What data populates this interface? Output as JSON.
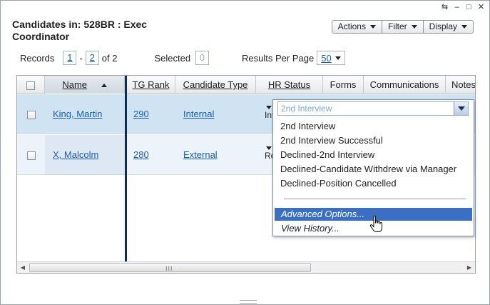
{
  "window": {
    "title_line": "Candidates in: 528BR : Exec Coordinator",
    "controls": {
      "refresh": "⇆",
      "minimize": "–",
      "maximize": "□",
      "close": "✕"
    }
  },
  "toolbar": {
    "actions": "Actions",
    "filter": "Filter",
    "display": "Display"
  },
  "pager": {
    "records_label": "Records",
    "start": "1",
    "dash": "-",
    "end": "2",
    "of_total": "of 2",
    "selected_label": "Selected",
    "selected_count": "0",
    "rpp_label": "Results Per Page",
    "rpp_value": "50"
  },
  "grid": {
    "columns": [
      "Name",
      "TG Rank",
      "Candidate Type",
      "HR Status",
      "Forms",
      "Communications",
      "Notes"
    ],
    "rows": [
      {
        "name": "King, Martin",
        "tg_rank": "290",
        "type": "Internal",
        "hr_status": "Int"
      },
      {
        "name": "X, Malcolm",
        "tg_rank": "280",
        "type": "External",
        "hr_status": "Rec"
      }
    ]
  },
  "dropdown": {
    "current": "2nd Interview",
    "options": [
      "2nd Interview",
      "2nd Interview Successful",
      "Declined-2nd Interview",
      "Declined-Candidate Withdrew via Manager",
      "Declined-Position Cancelled"
    ],
    "advanced": "Advanced Options...",
    "history": "View History..."
  },
  "scrollbar": {
    "grip": "III"
  },
  "colors": {
    "accent": "#1a5fb4",
    "highlight": "#3b6fc3",
    "row_selected": "#cfe3f3",
    "divider": "#0b2d5a"
  }
}
